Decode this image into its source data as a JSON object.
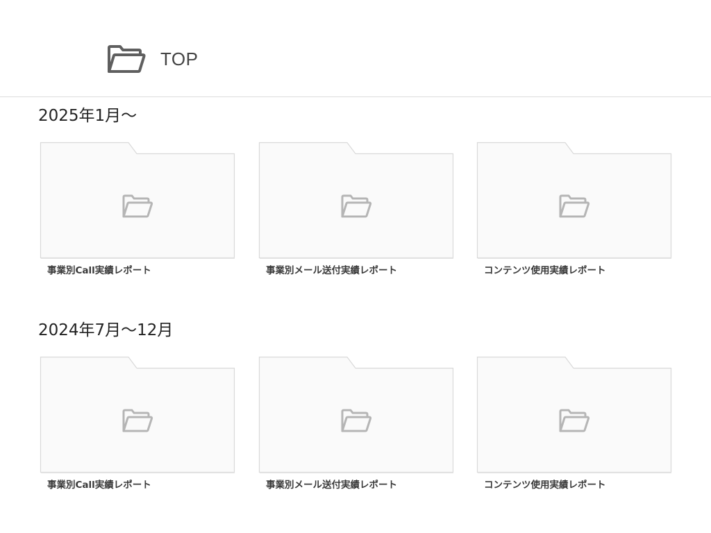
{
  "header": {
    "title": "TOP",
    "icon": "folder-open-icon",
    "icon_color": "#5f5f5f"
  },
  "sections": [
    {
      "title": "2025年1月〜",
      "folders": [
        {
          "label": "事業別Call実績レポート",
          "icon": "folder-open-icon"
        },
        {
          "label": "事業別メール送付実績レポート",
          "icon": "folder-open-icon"
        },
        {
          "label": "コンテンツ使用実績レポート",
          "icon": "folder-open-icon"
        }
      ]
    },
    {
      "title": "2024年7月〜12月",
      "folders": [
        {
          "label": "事業別Call実績レポート",
          "icon": "folder-open-icon"
        },
        {
          "label": "事業別メール送付実績レポート",
          "icon": "folder-open-icon"
        },
        {
          "label": "コンテンツ使用実績レポート",
          "icon": "folder-open-icon"
        }
      ]
    }
  ],
  "colors": {
    "folder_fill": "#fafafa",
    "folder_border": "#d9d9d9",
    "folder_icon": "#b5b5b5",
    "divider": "#dcdcdc"
  }
}
